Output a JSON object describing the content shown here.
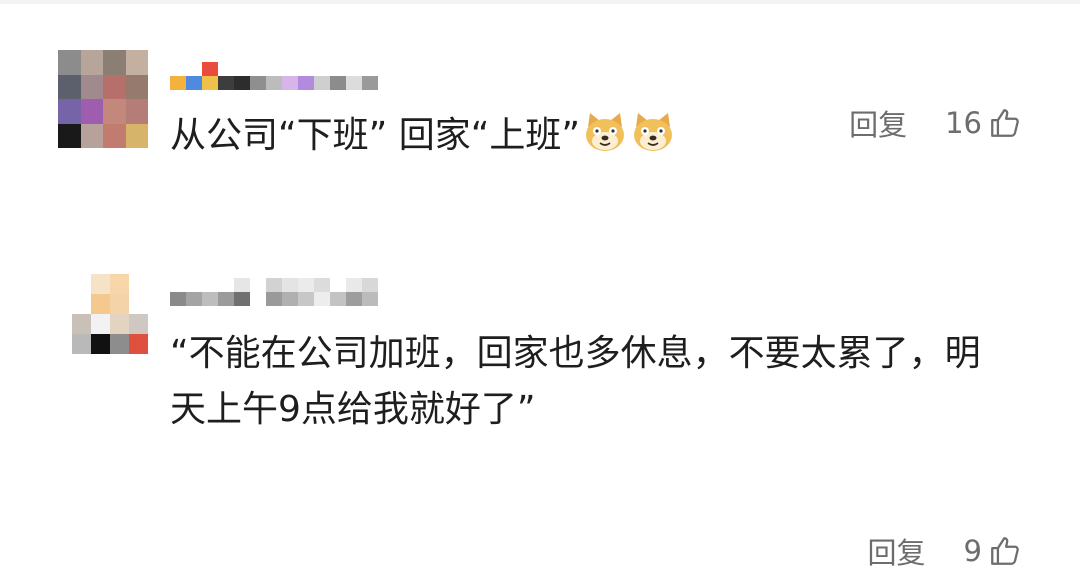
{
  "comments": [
    {
      "username": "",
      "reply_label": "回复",
      "likes": "16",
      "text": "从公司“下班” 回家“上班”",
      "emoji": [
        "doge-emoji",
        "doge-emoji"
      ]
    },
    {
      "username": "",
      "reply_label": "回复",
      "likes": "9",
      "text": "“不能在公司加班，回家也多休息，不要太累了，明天上午9点给我就好了”",
      "emoji": []
    }
  ],
  "icons": {
    "like": "thumbs-up-icon",
    "emoji": "doge-emoji"
  },
  "colors": {
    "action_gray": "#6d6d6d",
    "text": "#1e1e1e",
    "doge_yellow": "#f1c05a"
  }
}
